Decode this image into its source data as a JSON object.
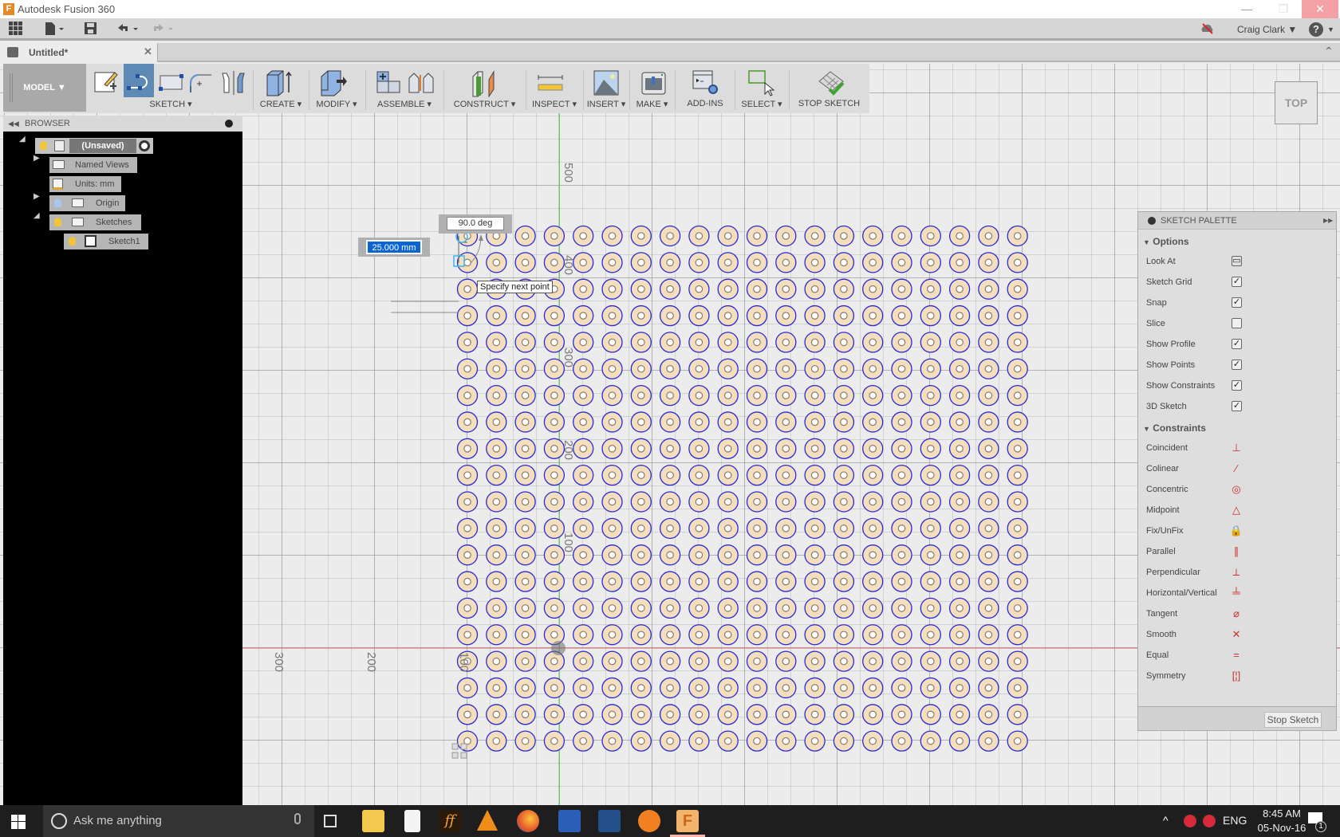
{
  "window": {
    "title": "Autodesk Fusion 360",
    "app_icon": "F",
    "minimize": "—",
    "restore": "❐",
    "close": "✕"
  },
  "qat": {
    "user": "Craig Clark ▼",
    "help": "?"
  },
  "document_tab": {
    "name": "Untitled*",
    "close": "✕"
  },
  "toolbar": {
    "workspace": "MODEL ▼",
    "groups": [
      {
        "label": "SKETCH ▾"
      },
      {
        "label": "CREATE ▾"
      },
      {
        "label": "MODIFY ▾"
      },
      {
        "label": "ASSEMBLE ▾"
      },
      {
        "label": "CONSTRUCT ▾"
      },
      {
        "label": "INSPECT ▾"
      },
      {
        "label": "INSERT ▾"
      },
      {
        "label": "MAKE ▾"
      },
      {
        "label": "ADD-INS"
      },
      {
        "label": "SELECT ▾"
      },
      {
        "label": "STOP SKETCH"
      }
    ]
  },
  "browser": {
    "title": "BROWSER",
    "items": [
      {
        "label": "(Unsaved)"
      },
      {
        "label": "Named Views"
      },
      {
        "label": "Units: mm"
      },
      {
        "label": "Origin"
      },
      {
        "label": "Sketches"
      },
      {
        "label": "Sketch1"
      }
    ]
  },
  "viewcube": {
    "face": "TOP"
  },
  "canvas": {
    "angle_input": "90.0 deg",
    "length_input": "25.000 mm",
    "tooltip": "Specify next point",
    "axis_labels_vertical": [
      "500",
      "400",
      "300",
      "200",
      "100"
    ],
    "axis_labels_horizontal": [
      "300",
      "200",
      "100"
    ],
    "pattern": {
      "rows": 20,
      "cols": 20
    },
    "colors": {
      "circle_fill": "#f3dfbe",
      "circle_stroke": "#2a2ad6",
      "x_axis": "#d86a6a",
      "y_axis": "#4fd04f"
    }
  },
  "sketch_palette": {
    "title": "SKETCH PALETTE",
    "options_label": "Options",
    "options": [
      {
        "label": "Look At",
        "type": "button"
      },
      {
        "label": "Sketch Grid",
        "checked": true
      },
      {
        "label": "Snap",
        "checked": true
      },
      {
        "label": "Slice",
        "checked": false
      },
      {
        "label": "Show Profile",
        "checked": true
      },
      {
        "label": "Show Points",
        "checked": true
      },
      {
        "label": "Show Constraints",
        "checked": true
      },
      {
        "label": "3D Sketch",
        "checked": true
      }
    ],
    "constraints_label": "Constraints",
    "constraints": [
      {
        "label": "Coincident",
        "icon": "⊥"
      },
      {
        "label": "Colinear",
        "icon": "⁄"
      },
      {
        "label": "Concentric",
        "icon": "◎"
      },
      {
        "label": "Midpoint",
        "icon": "△"
      },
      {
        "label": "Fix/UnFix",
        "icon": "🔒"
      },
      {
        "label": "Parallel",
        "icon": "∥"
      },
      {
        "label": "Perpendicular",
        "icon": "⟂"
      },
      {
        "label": "Horizontal/Vertical",
        "icon": "╧"
      },
      {
        "label": "Tangent",
        "icon": "⌀"
      },
      {
        "label": "Smooth",
        "icon": "✕"
      },
      {
        "label": "Equal",
        "icon": "="
      },
      {
        "label": "Symmetry",
        "icon": "[¦]"
      }
    ],
    "stop_button": "Stop Sketch"
  },
  "taskbar": {
    "search_placeholder": "Ask me anything",
    "language": "ENG",
    "time": "8:45 AM",
    "date": "05-Nov-16",
    "notification_count": "1"
  }
}
